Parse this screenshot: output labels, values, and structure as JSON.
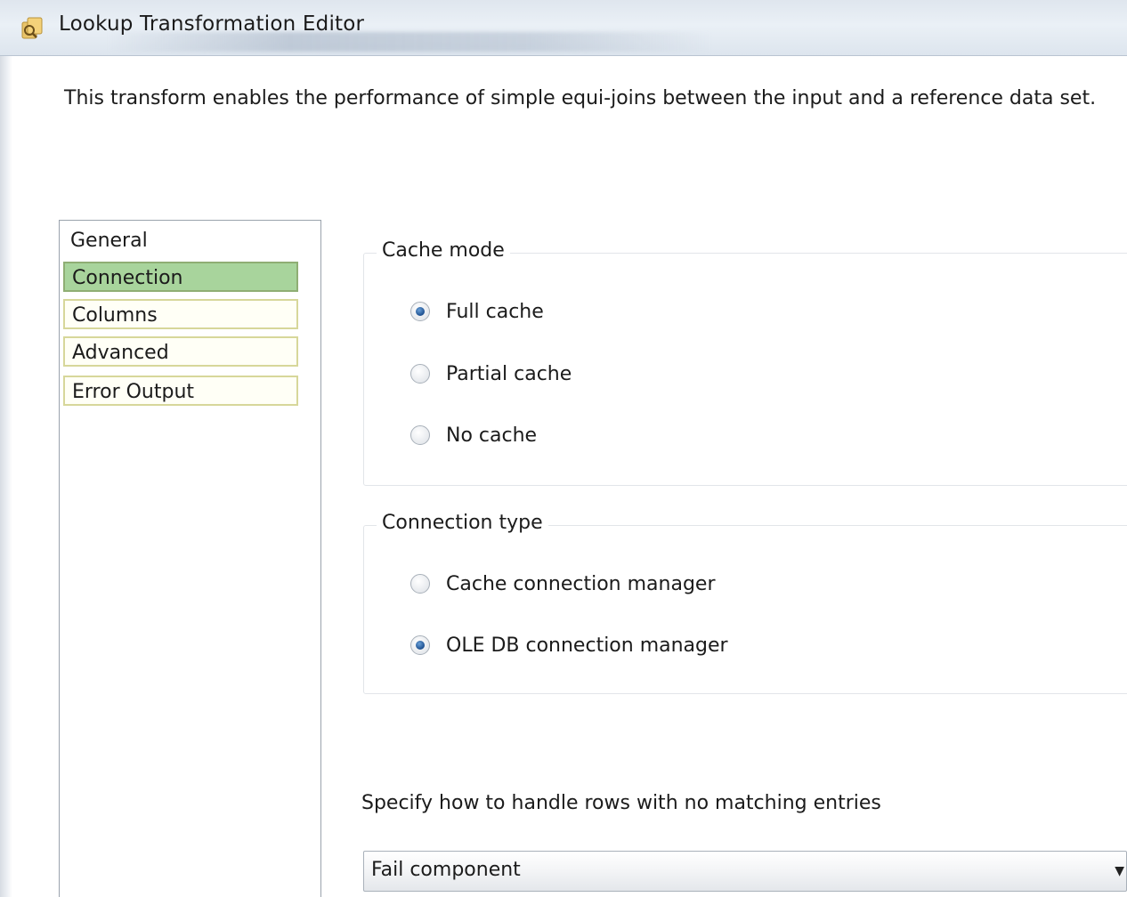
{
  "window": {
    "title": "Lookup Transformation Editor"
  },
  "description": "This transform enables the performance of simple equi-joins between the input and a reference data set.",
  "nav": {
    "items": [
      {
        "label": "General",
        "state": "plain"
      },
      {
        "label": "Connection",
        "state": "selected"
      },
      {
        "label": "Columns",
        "state": "boxed"
      },
      {
        "label": "Advanced",
        "state": "boxed"
      },
      {
        "label": "Error Output",
        "state": "boxed"
      }
    ]
  },
  "cache_mode": {
    "legend": "Cache mode",
    "options": [
      {
        "label": "Full cache",
        "checked": true
      },
      {
        "label": "Partial cache",
        "checked": false
      },
      {
        "label": "No cache",
        "checked": false
      }
    ]
  },
  "connection_type": {
    "legend": "Connection type",
    "options": [
      {
        "label": "Cache connection manager",
        "checked": false
      },
      {
        "label": "OLE DB connection manager",
        "checked": true
      }
    ]
  },
  "no_match": {
    "label": "Specify how to handle rows with no matching entries",
    "selected": "Fail component"
  },
  "icons": {
    "title_icon": "lookup-transform-icon",
    "dropdown_arrow": "chevron-down-icon"
  },
  "colors": {
    "selected_nav": "#a8d49c",
    "boxed_nav_border": "#d7d79a",
    "radio_dot": "#1c4f8f"
  }
}
